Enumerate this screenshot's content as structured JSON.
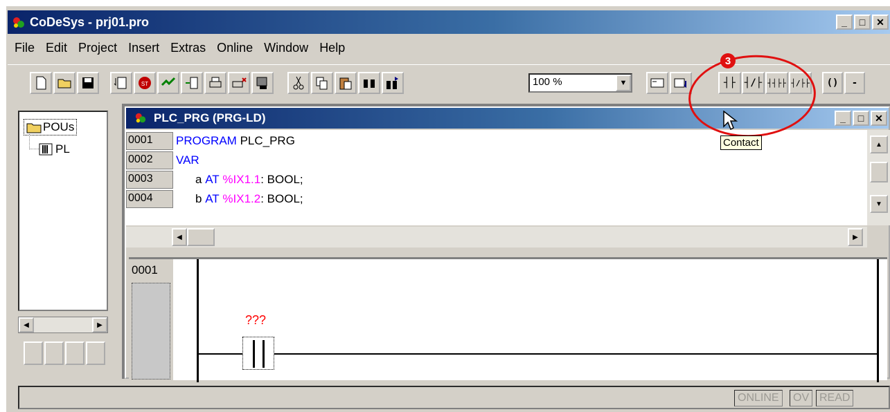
{
  "window": {
    "title": "CoDeSys - prj01.pro"
  },
  "menu": [
    "File",
    "Edit",
    "Project",
    "Insert",
    "Extras",
    "Online",
    "Window",
    "Help"
  ],
  "toolbar": {
    "zoom_value": "100 %"
  },
  "ld_buttons": [
    "┤├",
    "┤/├",
    "┤┤├├",
    "┤/├├"
  ],
  "tree": {
    "root_label": "POUs",
    "child_label": "PL"
  },
  "editor": {
    "title": "PLC_PRG (PRG-LD)",
    "lines": [
      {
        "num": "0001",
        "kw": "PROGRAM",
        "rest": " PLC_PRG"
      },
      {
        "num": "0002",
        "kw": "VAR",
        "rest": ""
      },
      {
        "num": "0003",
        "name": "a",
        "at": "AT",
        "addr": "%IX1.1",
        "type": ": BOOL;"
      },
      {
        "num": "0004",
        "name": "b",
        "at": "AT",
        "addr": "%IX1.2",
        "type": ": BOOL;"
      }
    ],
    "network_number": "0001",
    "contact_variable": "???"
  },
  "status": {
    "online": "ONLINE",
    "ov": "OV",
    "read": "READ"
  },
  "tooltip": "Contact",
  "annotation": {
    "badge": "3"
  }
}
